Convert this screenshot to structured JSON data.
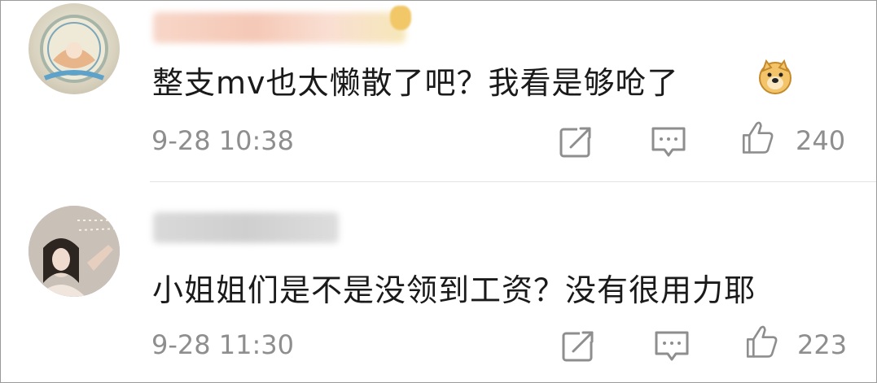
{
  "comments": [
    {
      "avatar": "avatar-illustration",
      "username": "",
      "text": "整支mv也太懒散了吧？我看是够呛了",
      "emoji": "doge-emoji",
      "time": "9-28 10:38",
      "likes": "240"
    },
    {
      "avatar": "avatar-photo",
      "username": "",
      "text": "小姐姐们是不是没领到工资？没有很用力耶",
      "time": "9-28 11:30",
      "likes": "223"
    }
  ],
  "colors": {
    "text": "#1a1a1a",
    "meta": "#8e8e8e",
    "divider": "#e3e3e3"
  },
  "icons": [
    "share-icon",
    "comment-icon",
    "like-icon"
  ]
}
